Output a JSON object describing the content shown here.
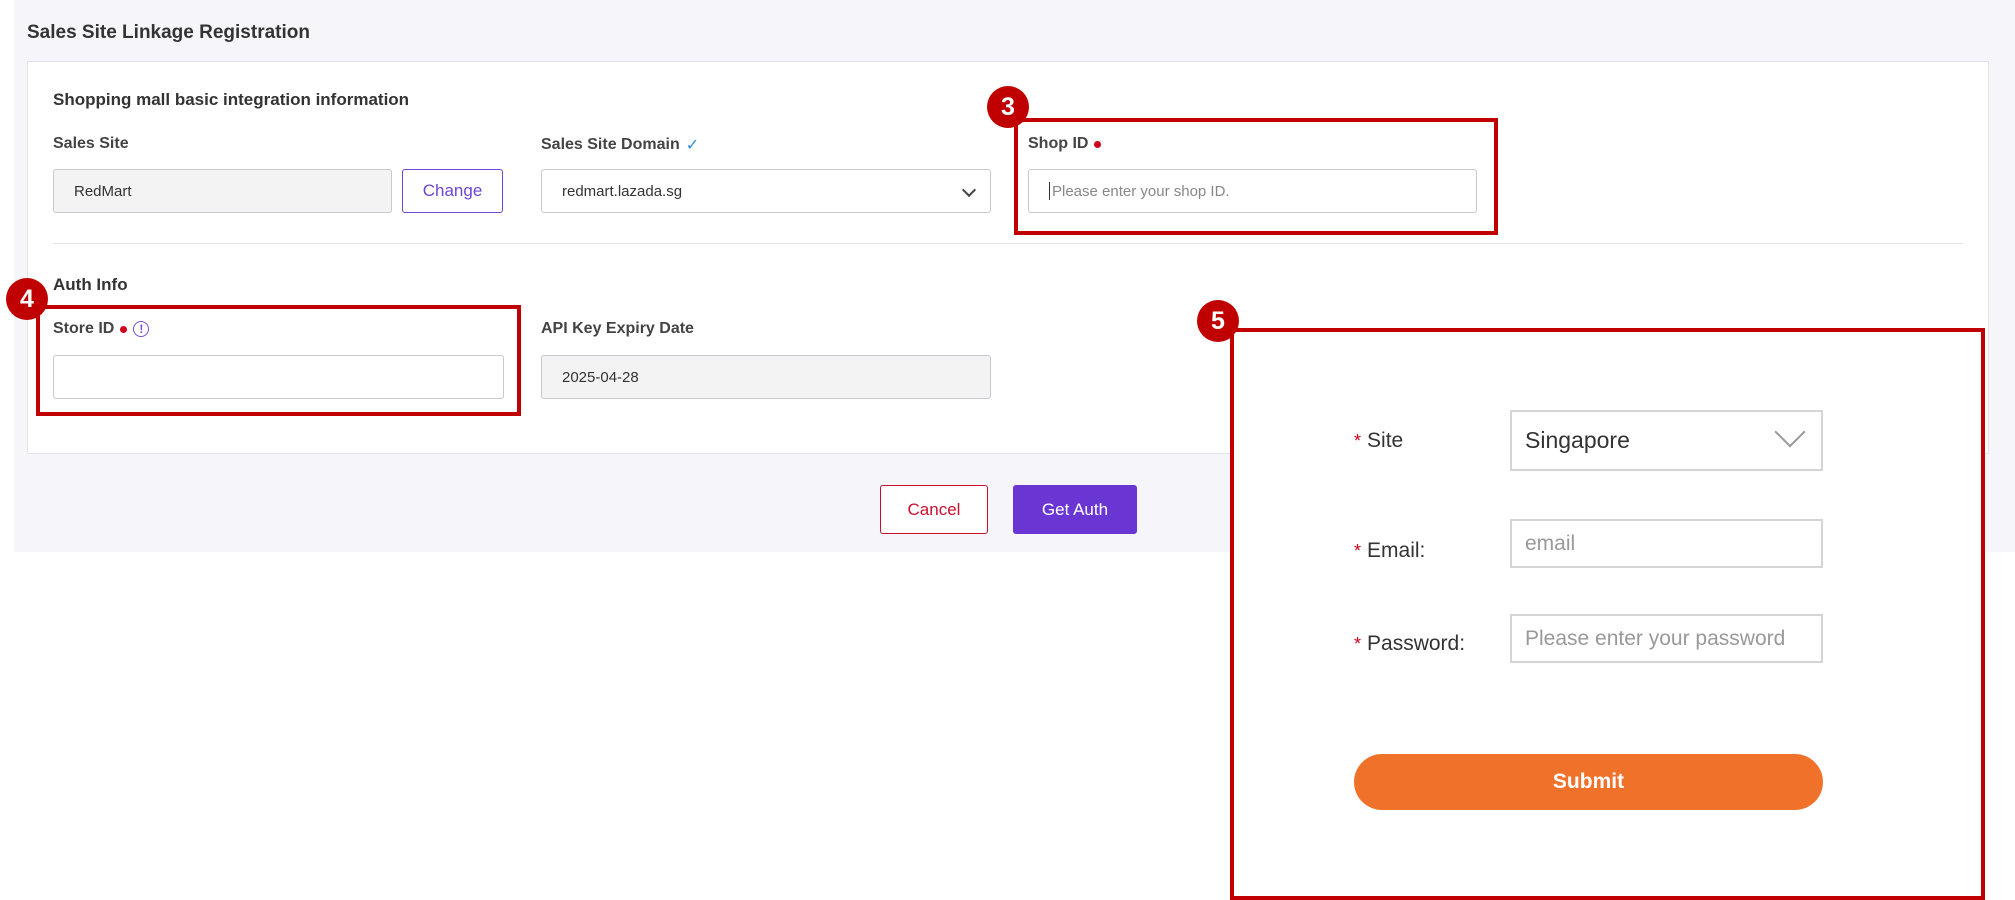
{
  "page": {
    "title": "Sales Site Linkage Registration"
  },
  "basic_section": {
    "title": "Shopping mall basic integration information",
    "sales_site": {
      "label": "Sales Site",
      "value": "RedMart",
      "change_button": "Change"
    },
    "sales_site_domain": {
      "label": "Sales Site Domain",
      "value": "redmart.lazada.sg"
    },
    "shop_id": {
      "label": "Shop ID",
      "placeholder": "Please enter your shop ID."
    }
  },
  "auth_section": {
    "title": "Auth Info",
    "store_id": {
      "label": "Store ID",
      "value": ""
    },
    "api_key_expiry": {
      "label": "API Key Expiry Date",
      "value": "2025-04-28"
    }
  },
  "actions": {
    "cancel": "Cancel",
    "get_auth": "Get Auth"
  },
  "callouts": {
    "shop_id_badge": "3",
    "store_id_badge": "4",
    "login_badge": "5"
  },
  "login_popup": {
    "site": {
      "label": "Site",
      "value": "Singapore"
    },
    "email": {
      "label": "Email:",
      "placeholder": "email"
    },
    "password": {
      "label": "Password:",
      "placeholder": "Please enter your password"
    },
    "submit": "Submit",
    "required_mark": "*"
  },
  "colors": {
    "primary_purple": "#6a36d3",
    "highlight_red": "#c00000",
    "submit_orange": "#f0722a",
    "required_red": "#d0021b"
  }
}
